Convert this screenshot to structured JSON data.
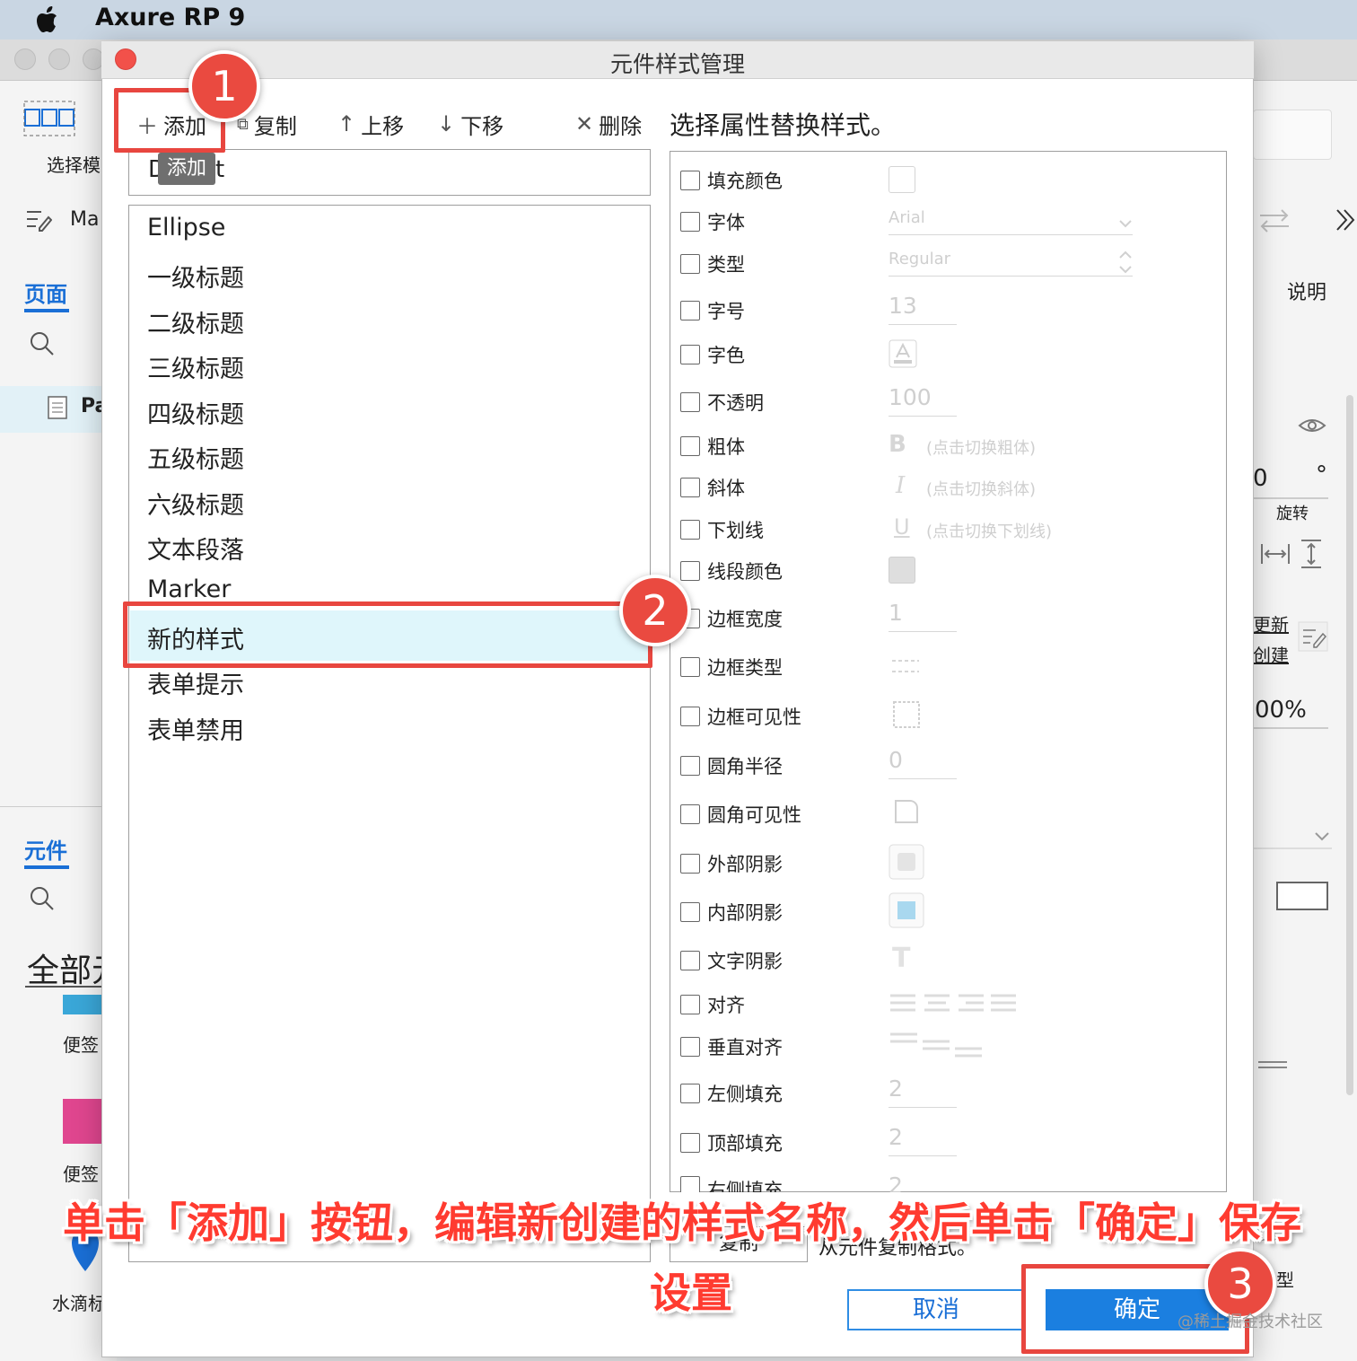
{
  "menubar": {
    "app_name": "Axure RP 9"
  },
  "background_app": {
    "select_mode_label": "选择模",
    "tab_pages": "页面",
    "manage_label": "Ma",
    "page_item": "Pa",
    "tab_widgets": "元件",
    "all_label": "全部元",
    "widget_labels": [
      "便签",
      "便签",
      "水滴标"
    ],
    "right_tab": "说明",
    "rotate_label": "旋转",
    "rotate_value": "0",
    "degree": "°",
    "update_label": "更新",
    "create_label": "创建",
    "opacity_value": "00%",
    "type_suffix": "型"
  },
  "dialog": {
    "title": "元件样式管理",
    "toolbar": {
      "add": "添加",
      "copy": "复制",
      "move_up": "上移",
      "move_down": "下移",
      "delete": "删除"
    },
    "style_name_field": "D",
    "style_name_tail": "t",
    "tooltip": "添加",
    "styles": [
      "Ellipse",
      "一级标题",
      "二级标题",
      "三级标题",
      "四级标题",
      "五级标题",
      "六级标题",
      "文本段落",
      "Marker",
      "新的样式",
      "表单提示",
      "表单禁用"
    ],
    "selected_style": "新的样式",
    "properties_heading": "选择属性替换样式。",
    "properties": [
      {
        "label": "填充颜色"
      },
      {
        "label": "字体",
        "value": "Arial"
      },
      {
        "label": "类型",
        "value": "Regular"
      },
      {
        "label": "字号",
        "value": "13"
      },
      {
        "label": "字色"
      },
      {
        "label": "不透明",
        "value": "100"
      },
      {
        "label": "粗体",
        "value": "(点击切换粗体)"
      },
      {
        "label": "斜体",
        "value": "(点击切换斜体)"
      },
      {
        "label": "下划线",
        "value": "(点击切换下划线)"
      },
      {
        "label": "线段颜色"
      },
      {
        "label": "边框宽度",
        "value": "1"
      },
      {
        "label": "边框类型"
      },
      {
        "label": "边框可见性"
      },
      {
        "label": "圆角半径",
        "value": "0"
      },
      {
        "label": "圆角可见性"
      },
      {
        "label": "外部阴影"
      },
      {
        "label": "内部阴影"
      },
      {
        "label": "文字阴影"
      },
      {
        "label": "对齐"
      },
      {
        "label": "垂直对齐"
      },
      {
        "label": "左侧填充",
        "value": "2"
      },
      {
        "label": "顶部填充",
        "value": "2"
      },
      {
        "label": "右侧填充",
        "value": "2"
      }
    ],
    "copy_button": "复制",
    "copy_note": "从元件复制格式。",
    "cancel_button": "取消",
    "ok_button": "确定"
  },
  "annotations": {
    "badges": [
      "1",
      "2",
      "3"
    ],
    "caption_line1": "单击「添加」按钮，编辑新创建的样式名称，然后单击「确定」保存",
    "caption_line2": "设置",
    "watermark": "@稀土掘金技术社区"
  },
  "colors": {
    "accent": "#1b7fe0",
    "annotation_red": "#e8463f",
    "selected_row": "#dff6fb",
    "close_button": "#f2514a"
  }
}
